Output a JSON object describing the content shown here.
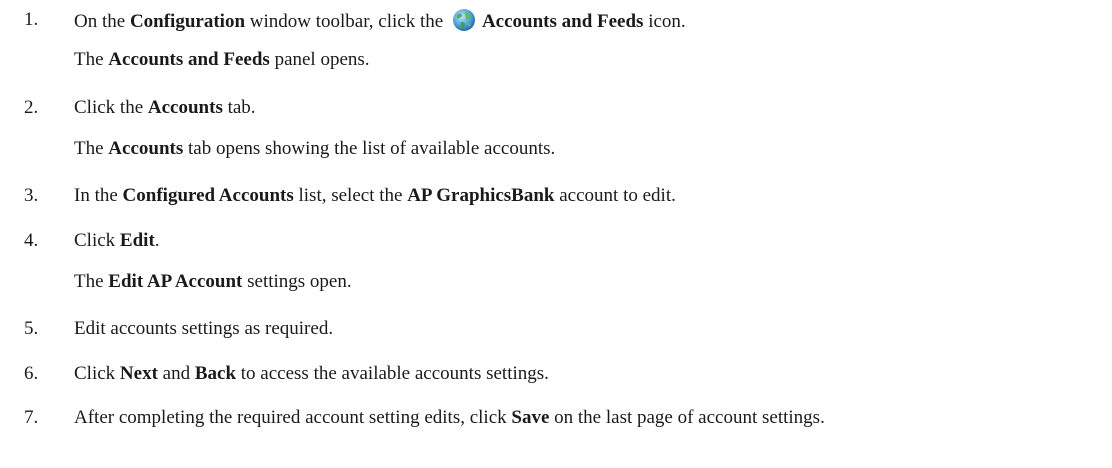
{
  "steps": [
    {
      "number": "1.",
      "text_a": "On the ",
      "b1": "Configuration",
      "text_b": " window toolbar, click the ",
      "icon": "globe-icon",
      "b2": "Accounts and Feeds",
      "text_c": " icon."
    },
    {
      "result_a": "The ",
      "result_b": "Accounts and Feeds",
      "result_c": " panel opens."
    },
    {
      "number": "2.",
      "text_a": "Click the ",
      "b1": "Accounts",
      "text_b": " tab."
    },
    {
      "result_a": "The ",
      "result_b": "Accounts",
      "result_c": " tab opens showing the list of available accounts."
    },
    {
      "number": "3.",
      "text_a": "In the ",
      "b1": "Configured Accounts",
      "text_b": " list, select the ",
      "b2": "AP GraphicsBank",
      "text_c": " account to edit."
    },
    {
      "number": "4.",
      "text_a": "Click ",
      "b1": "Edit",
      "text_b": "."
    },
    {
      "result_a": "The ",
      "result_b": "Edit AP Account",
      "result_c": " settings open."
    },
    {
      "number": "5.",
      "text_a": "Edit accounts settings as required."
    },
    {
      "number": "6.",
      "text_a": "Click ",
      "b1": "Next",
      "text_b": " and ",
      "b2": "Back",
      "text_c": " to access the available accounts settings."
    },
    {
      "number": "7.",
      "text_a": "After completing the required account setting edits, click ",
      "b1": "Save",
      "text_b": " on the last page of account settings."
    }
  ]
}
